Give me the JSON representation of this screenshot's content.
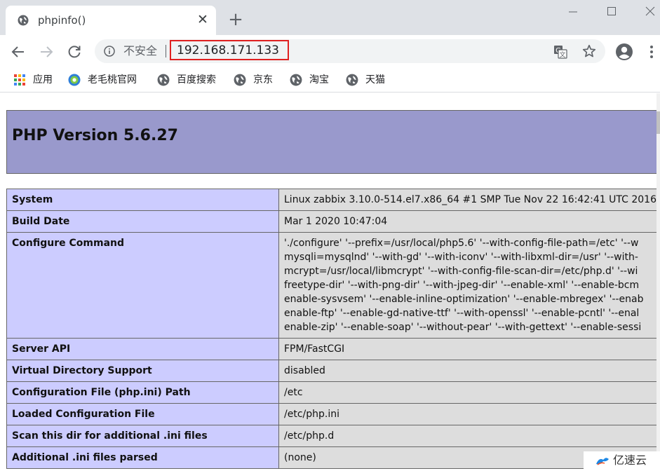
{
  "tab": {
    "title": "phpinfo()",
    "favicon": "globe-icon"
  },
  "window_controls": [
    "minimize-icon",
    "maximize-icon",
    "close-icon"
  ],
  "toolbar": {
    "security_label": "不安全",
    "url": "192.168.171.133",
    "url_highlight_color": "#e02020"
  },
  "bookmarks": [
    {
      "label": "应用",
      "icon": "apps-grid-icon"
    },
    {
      "label": "老毛桃官网",
      "icon": "laomaotao-icon"
    },
    {
      "label": "百度搜索",
      "icon": "globe-icon"
    },
    {
      "label": "京东",
      "icon": "globe-icon"
    },
    {
      "label": "淘宝",
      "icon": "globe-icon"
    },
    {
      "label": "天猫",
      "icon": "globe-icon"
    }
  ],
  "php": {
    "header_title": "PHP Version 5.6.27",
    "header_color": "#9999cc",
    "key_color": "#ccccff",
    "value_color": "#dddddd",
    "rows": [
      {
        "key": "System",
        "value": "Linux zabbix 3.10.0-514.el7.x86_64 #1 SMP Tue Nov 22 16:42:41 UTC 2016"
      },
      {
        "key": "Build Date",
        "value": "Mar 1 2020 10:47:04"
      },
      {
        "key": "Configure Command",
        "lines": [
          "'./configure' '--prefix=/usr/local/php5.6' '--with-config-file-path=/etc' '--w",
          "mysqli=mysqlnd' '--with-gd' '--with-iconv' '--with-libxml-dir=/usr' '--with-",
          "mcrypt=/usr/local/libmcrypt' '--with-config-file-scan-dir=/etc/php.d' '--wi",
          "freetype-dir' '--with-png-dir' '--with-jpeg-dir' '--enable-xml' '--enable-bcm",
          "enable-sysvsem' '--enable-inline-optimization' '--enable-mbregex' '--enab",
          "enable-ftp' '--enable-gd-native-ttf' '--with-openssl' '--enable-pcntl' '--enal",
          "enable-zip' '--enable-soap' '--without-pear' '--with-gettext' '--enable-sessi"
        ]
      },
      {
        "key": "Server API",
        "value": "FPM/FastCGI"
      },
      {
        "key": "Virtual Directory Support",
        "value": "disabled"
      },
      {
        "key": "Configuration File (php.ini) Path",
        "value": "/etc"
      },
      {
        "key": "Loaded Configuration File",
        "value": "/etc/php.ini"
      },
      {
        "key": "Scan this dir for additional .ini files",
        "value": "/etc/php.d"
      },
      {
        "key": "Additional .ini files parsed",
        "value": "(none)"
      }
    ]
  },
  "watermark": {
    "text": "亿速云",
    "icon": "yisuyun-logo-icon"
  }
}
